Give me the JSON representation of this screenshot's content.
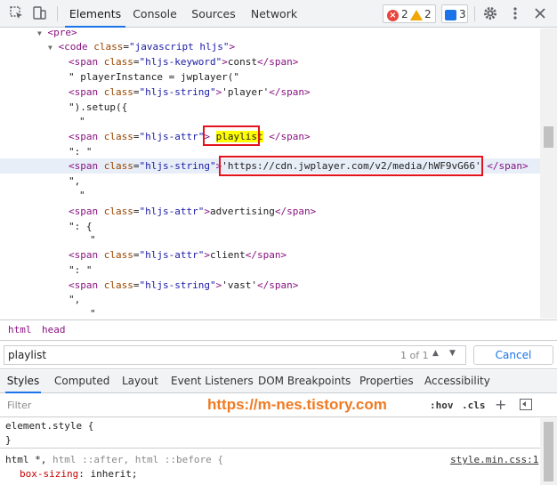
{
  "toolbar": {
    "tabs": [
      {
        "label": "Elements"
      },
      {
        "label": "Console"
      },
      {
        "label": "Sources"
      },
      {
        "label": "Network"
      }
    ],
    "errors": "2",
    "warnings": "2",
    "messages": "3"
  },
  "tree": {
    "lines": {
      "pre_open": "<pre>",
      "code_tag": "code",
      "code_attr": "class",
      "code_val": "\"javascript hljs\"",
      "l1_class": "\"hljs-keyword\"",
      "l1_text": "const",
      "l2_text": "\" playerInstance = jwplayer(\"",
      "l3_class": "\"hljs-string\"",
      "l3_text": "'player'",
      "l4_text": "\").setup({",
      "l5_text": "\"",
      "l6_class": "\"hljs-attr\"",
      "l6_text": "playlist",
      "l7_text": "\": \"",
      "l8_class": "\"hljs-string\"",
      "l8_text": "'https://cdn.jwplayer.com/v2/media/hWF9vG66'",
      "l9_text": "\",",
      "l10_text": "\"",
      "l11_class": "\"hljs-attr\"",
      "l11_text": "advertising",
      "l12_text": "\": {",
      "l13_text": "\"",
      "l14_class": "\"hljs-attr\"",
      "l14_text": "client",
      "l15_text": "\": \"",
      "l16_class": "\"hljs-string\"",
      "l16_text": "'vast'",
      "l17_text": "\",",
      "l18_text": "\"",
      "span": "span"
    }
  },
  "breadcrumb": [
    "html",
    "head"
  ],
  "search": {
    "value": "playlist",
    "count": "1 of 1",
    "cancel": "Cancel"
  },
  "subtabs": [
    "Styles",
    "Computed",
    "Layout",
    "Event Listeners",
    "DOM Breakpoints",
    "Properties",
    "Accessibility"
  ],
  "filter": {
    "placeholder": "Filter",
    "hov": ":hov",
    "cls": ".cls",
    "watermark": "https://m-nes.tistory.com"
  },
  "styles": {
    "element_style": "element.style {",
    "close_brace": "}",
    "rule_selector_main": "html *,",
    "rule_selector_rest": " html ::after, html ::before {",
    "prop_name": "box-sizing",
    "prop_value": ": inherit;",
    "source": "style.min.css:1"
  }
}
